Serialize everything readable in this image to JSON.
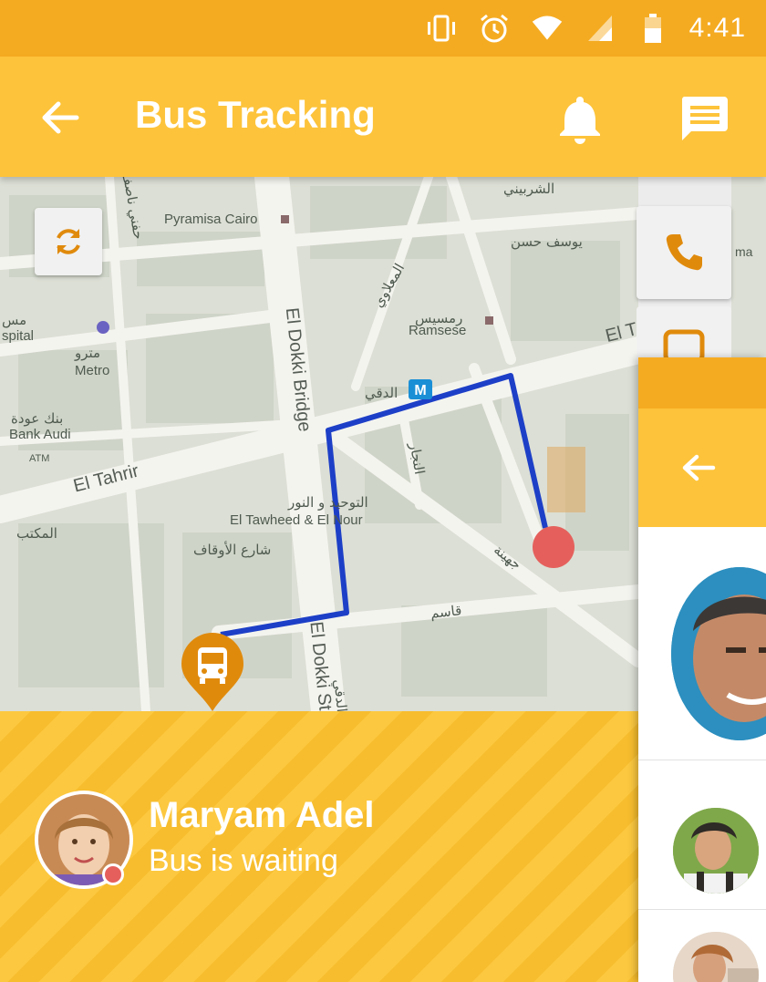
{
  "status_bar": {
    "time": "4:41",
    "icons": [
      "vibrate-icon",
      "alarm-icon",
      "wifi-icon",
      "signal-icon",
      "battery-icon"
    ]
  },
  "app_bar": {
    "title": "Bus Tracking",
    "back_icon": "arrow-left-icon",
    "notification_icon": "bell-icon",
    "message_icon": "chat-icon"
  },
  "map": {
    "labels": {
      "pyramisa": "Pyramisa Cairo",
      "ramsese": "Ramsese",
      "ramsese_ar": "رمسيس",
      "metro_ar": "مترو",
      "metro": "Metro",
      "bank_ar": "بنك عودة",
      "bank": "Bank Audi",
      "atm": "ATM",
      "tawheed_ar": "التوحيد و النور",
      "tawheed": "El Tawheed & El Nour",
      "hospital": "spital",
      "hospital_ar": "مس",
      "el_tahrir": "El Tahrir",
      "el_dokki_bridge": "El Dokki Bridge",
      "el_dokki_st": "El Dokki St",
      "dokki_ar": "الدقي",
      "sherbiny_ar": "الشربيني",
      "youssef_hassan_ar": "يوسف حسن",
      "maktab_ar": "المكتب",
      "awqaf_ar": "شارع الأوقاف",
      "qasem_ar": "قاسم",
      "gohayna_ar": "جهينة",
      "naggar_ar": "النجار",
      "maalawi_ar": "المعلاوي",
      "hafny_ar": "حفني ناصف",
      "dokki_side_ar": "الدقي",
      "el_t": "El T",
      "metro_station": "M"
    },
    "refresh_icon": "refresh-icon",
    "bus_icon": "bus-icon",
    "route_color": "#1d3fc7",
    "destination_color": "#e5605c"
  },
  "info_card": {
    "name": "Maryam Adel",
    "status": "Bus is waiting"
  },
  "side": {
    "call_icon": "phone-icon",
    "peek_label": "ma"
  },
  "colors": {
    "primary": "#fdc33a",
    "primary_dark": "#f5ab21",
    "accent": "#e08a0c"
  }
}
